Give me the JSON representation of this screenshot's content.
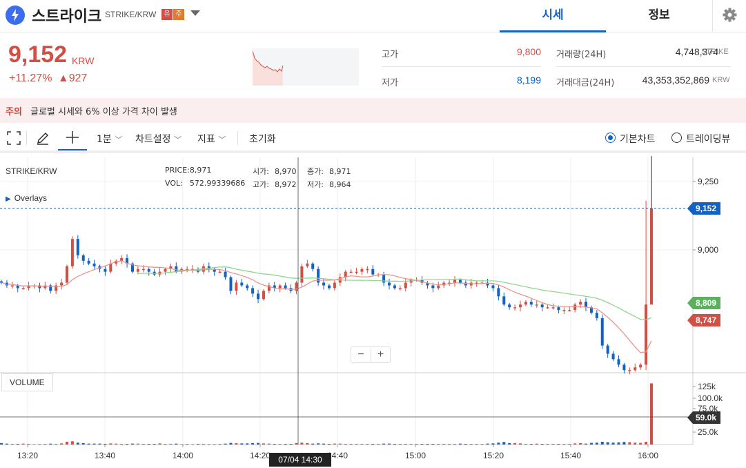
{
  "header": {
    "coin_name": "스트라이크",
    "pair": "STRIKE/KRW",
    "badge_yu": "유",
    "badge_ju": "주",
    "tabs": [
      "시세",
      "정보"
    ]
  },
  "price": {
    "current": "9,152",
    "unit": "KRW",
    "change_pct": "+11.27%",
    "change_arrow": "▲",
    "change_abs": "927"
  },
  "stats": {
    "high_label": "고가",
    "high_value": "9,800",
    "low_label": "저가",
    "low_value": "8,199",
    "volume_label": "거래량(24H)",
    "volume_value": "4,748,374",
    "volume_unit": "STRIKE",
    "amount_label": "거래대금(24H)",
    "amount_value": "43,353,352,869",
    "amount_unit": "KRW"
  },
  "warning": {
    "label": "주의",
    "text": "글로벌 시세와 6% 이상 가격 차이 발생"
  },
  "toolbar": {
    "interval": "1분",
    "chart_settings": "차트설정",
    "indicator": "지표",
    "reset": "초기화",
    "basic_chart": "기본차트",
    "trading_view": "트레이딩뷰"
  },
  "chart_info": {
    "pair": "STRIKE/KRW",
    "price_label": "PRICE:",
    "price_value": "8,971",
    "vol_label": "VOL:",
    "vol_value": "572.99339686",
    "open_label": "시가:",
    "open_value": "8,970",
    "high_label": "고가:",
    "high_value": "8,972",
    "close_label": "종가:",
    "close_value": "8,971",
    "low_label": "저가:",
    "low_value": "8,964",
    "overlays": "Overlays",
    "volume_panel": "VOLUME",
    "crosshair_time": "07/04 14:30"
  },
  "price_labels": {
    "current": "9,152",
    "ma_green": "8,809",
    "ma_red": "8,747",
    "volume_current": "59.0k"
  },
  "colors": {
    "up": "#d24f45",
    "down": "#1261c4",
    "ma_short": "#e9958d",
    "ma_long": "#8fd68f",
    "accent": "#1261c4"
  },
  "chart_data": {
    "type": "candlestick",
    "y_ticks": [
      "9,250",
      "9,000"
    ],
    "volume_ticks": [
      "125k",
      "100.0k",
      "75.0k",
      "25.0k"
    ],
    "x_ticks": [
      "13:20",
      "13:40",
      "14:00",
      "14:20",
      "14:40",
      "15:00",
      "15:20",
      "15:40",
      "16:00"
    ],
    "ylim": [
      8450,
      9350
    ],
    "volume_ylim": [
      0,
      140000
    ],
    "series_close": [
      8880,
      8870,
      8870,
      8860,
      8860,
      8870,
      8870,
      8860,
      8870,
      8850,
      8870,
      8880,
      8940,
      9040,
      8980,
      8960,
      8950,
      8940,
      8930,
      8920,
      8950,
      8960,
      8970,
      8950,
      8920,
      8930,
      8930,
      8920,
      8910,
      8920,
      8930,
      8940,
      8920,
      8930,
      8930,
      8930,
      8920,
      8940,
      8930,
      8920,
      8920,
      8900,
      8850,
      8880,
      8870,
      8860,
      8840,
      8820,
      8850,
      8870,
      8860,
      8870,
      8860,
      8850,
      8880,
      8940,
      8950,
      8930,
      8880,
      8870,
      8860,
      8880,
      8900,
      8920,
      8920,
      8920,
      8930,
      8930,
      8910,
      8910,
      8880,
      8870,
      8860,
      8860,
      8880,
      8890,
      8890,
      8880,
      8870,
      8860,
      8870,
      8880,
      8880,
      8890,
      8880,
      8870,
      8880,
      8880,
      8880,
      8870,
      8860,
      8830,
      8800,
      8790,
      8790,
      8800,
      8810,
      8800,
      8800,
      8790,
      8790,
      8790,
      8780,
      8780,
      8780,
      8800,
      8810,
      8790,
      8770,
      8750,
      8650,
      8620,
      8600,
      8580,
      8560,
      8560,
      8570,
      8580,
      8800,
      9152
    ],
    "volume": [
      3000,
      2000,
      1500,
      1500,
      2000,
      1500,
      1000,
      1000,
      1500,
      2000,
      1500,
      2500,
      6000,
      7000,
      4000,
      3000,
      2000,
      2000,
      2000,
      1500,
      2500,
      2000,
      1500,
      1500,
      2000,
      2000,
      1500,
      1500,
      1500,
      2500,
      1500,
      1500,
      2000,
      1000,
      1500,
      1000,
      1500,
      1500,
      1000,
      1000,
      1500,
      2000,
      3500,
      3000,
      2500,
      2500,
      3000,
      3500,
      2500,
      2000,
      1500,
      1500,
      1500,
      1500,
      3000,
      4000,
      3000,
      2000,
      2500,
      2000,
      1500,
      2000,
      2000,
      1500,
      1500,
      1500,
      1500,
      1500,
      1500,
      1500,
      2000,
      2000,
      1500,
      1500,
      1500,
      1500,
      1500,
      1500,
      1500,
      1500,
      1500,
      1500,
      1500,
      1500,
      2000,
      1500,
      1500,
      1500,
      1500,
      2000,
      2500,
      4000,
      5500,
      3000,
      3000,
      2500,
      1500,
      1500,
      2000,
      1500,
      1500,
      1500,
      1500,
      1500,
      1500,
      2500,
      3000,
      2000,
      3500,
      4000,
      6000,
      5000,
      4000,
      4500,
      5500,
      5000,
      4000,
      3500,
      6000,
      132000
    ]
  }
}
